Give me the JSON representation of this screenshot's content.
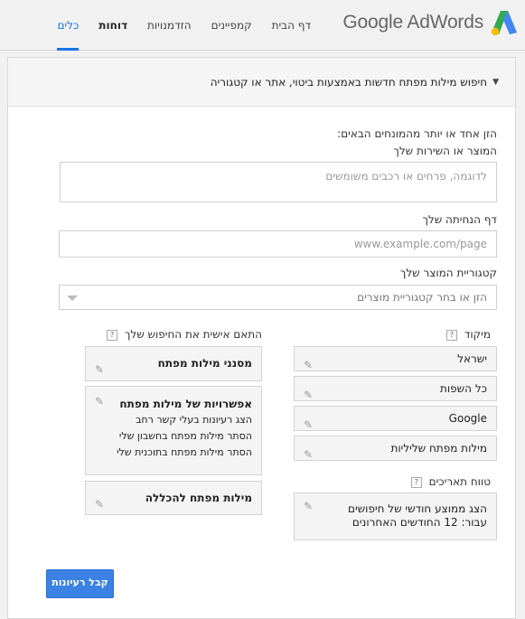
{
  "app": {
    "brand": "Google AdWords"
  },
  "nav": [
    {
      "label": "דף הבית"
    },
    {
      "label": "קמפיינים"
    },
    {
      "label": "הזדמנויות"
    },
    {
      "label": "דוחות"
    },
    {
      "label": "כלים"
    }
  ],
  "section": {
    "title": "חיפוש מילות מפתח חדשות באמצעות ביטוי, אתר או קטגוריה"
  },
  "form": {
    "intro": "הזן אחד או יותר מהמונחים הבאים:",
    "product_label": "המוצר או השירות שלך",
    "product_placeholder": "לדוגמה, פרחים או רכבים משומשים",
    "landing_label": "דף הנחיתה שלך",
    "landing_placeholder": "www.example.com/page",
    "category_label": "קטגוריית המוצר שלך",
    "category_placeholder": "הזן או בחר קטגוריית מוצרים"
  },
  "targeting": {
    "label": "מיקוד",
    "items": [
      "ישראל",
      "כל השפות",
      "Google",
      "מילות מפתח שליליות"
    ]
  },
  "daterange": {
    "label": "טווח תאריכים",
    "line1": "הצג ממוצע חודשי של חיפושים",
    "line2": "עבור: 12 החודשים האחרונים"
  },
  "customize": {
    "label": "התאם אישית את החיפוש שלך",
    "filters": "מסנני מילות מפתח",
    "options_title": "אפשרויות של מילות מפתח",
    "options": [
      "הצג רעיונות בעלי קשר רחב",
      "הסתר מילות מפתח בחשבון שלי",
      "הסתר מילות מפתח בתוכנית שלי"
    ],
    "include": "מילות מפתח להכללה"
  },
  "help_glyph": "?",
  "button": {
    "label": "קבל רעיונות"
  },
  "colors": {
    "accent": "#1a73e8",
    "button": "#3b82e4"
  }
}
